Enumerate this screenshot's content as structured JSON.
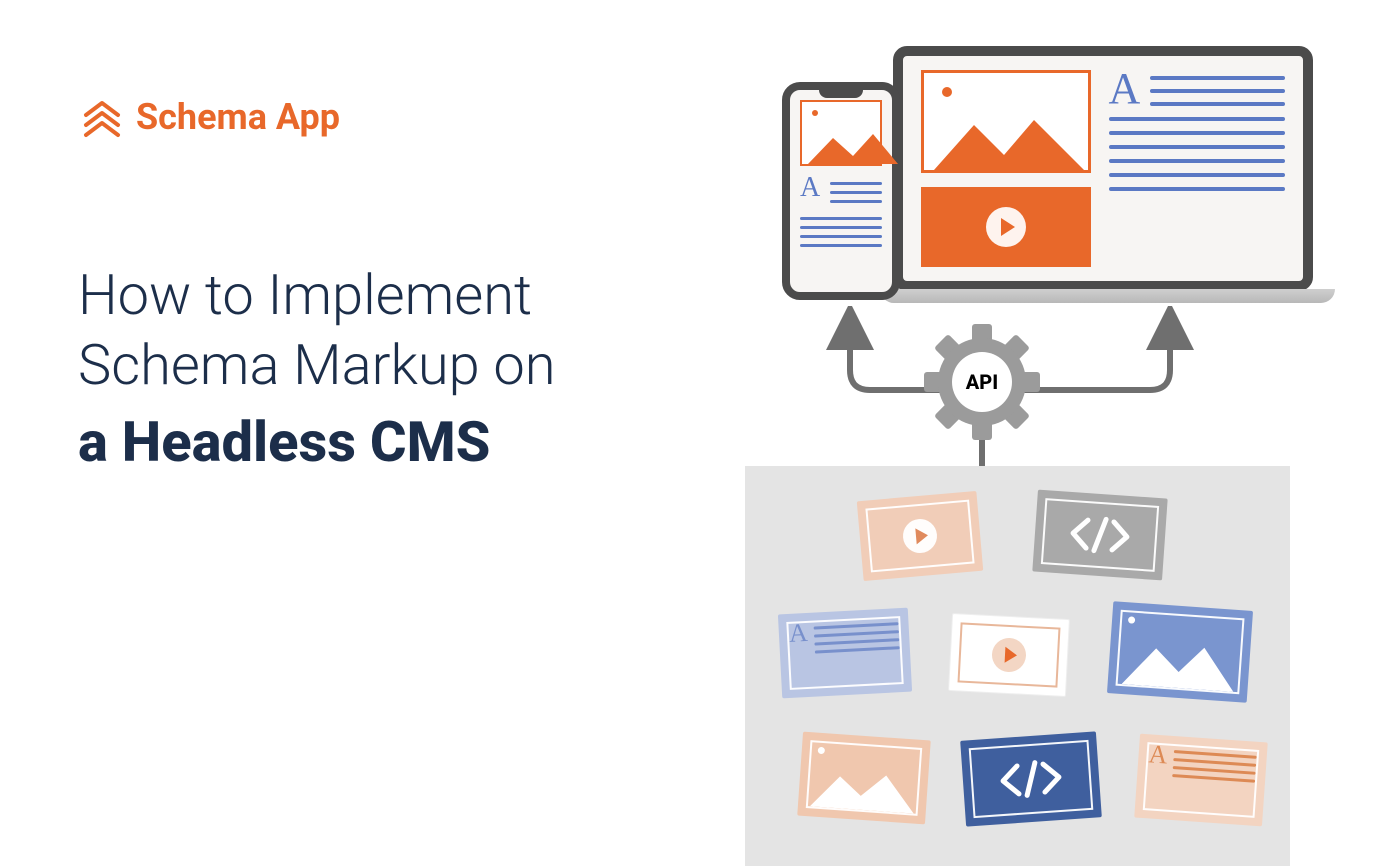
{
  "brand": {
    "name": "Schema App"
  },
  "heading": {
    "line1": "How to Implement",
    "line2": "Schema Markup on",
    "line3": "a Headless CMS"
  },
  "diagram": {
    "api_label": "API",
    "text_glyph": "A"
  },
  "colors": {
    "accent": "#e8682a",
    "navy": "#1c2e4a",
    "blueline": "#5b79c4",
    "gear": "#9b9b9b"
  }
}
